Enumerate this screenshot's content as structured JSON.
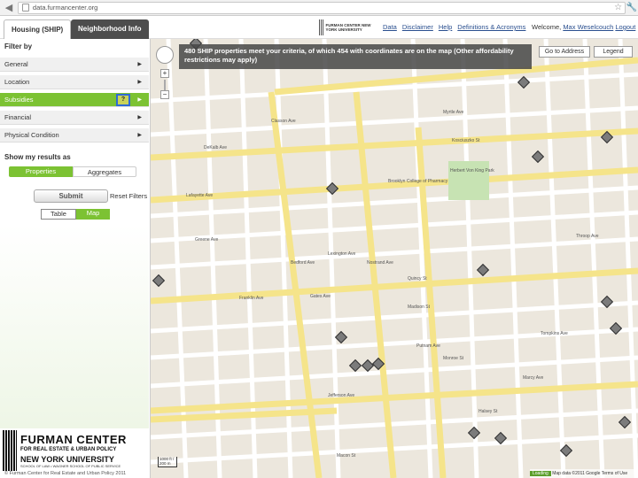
{
  "browser": {
    "url": "data.furmancenter.org"
  },
  "header": {
    "tabs": [
      {
        "label": "Housing (SHIP)"
      },
      {
        "label": "Neighborhood Info"
      }
    ],
    "links": [
      "Data",
      "Disclaimer",
      "Help",
      "Definitions & Acronyms"
    ],
    "welcome_prefix": "Welcome,",
    "user_name": "Max Weselcouch",
    "logout": "Logout",
    "nyu_logo_text": "FURMAN CENTER NEW YORK UNIVERSITY"
  },
  "sidebar": {
    "filter_title": "Filter by",
    "categories": [
      {
        "label": "General"
      },
      {
        "label": "Location"
      },
      {
        "label": "Subsidies"
      },
      {
        "label": "Financial"
      },
      {
        "label": "Physical Condition"
      }
    ],
    "help_label": "?",
    "show_results_title": "Show my results as",
    "result_modes": [
      "Properties",
      "Aggregates"
    ],
    "submit_label": "Submit",
    "reset_label": "Reset Filters",
    "view_modes": [
      "Table",
      "Map"
    ],
    "logo": {
      "line1": "FURMAN CENTER",
      "line2": "FOR REAL ESTATE & URBAN POLICY",
      "line3": "NEW YORK UNIVERSITY",
      "line4": "SCHOOL OF LAW • WAGNER SCHOOL OF PUBLIC SERVICE"
    },
    "copyright": "© Furman Center for Real Estate and Urban Policy 2011"
  },
  "map": {
    "banner_text": "480 SHIP properties meet your criteria, of which 454 with coordinates are on the map (Other affordability restrictions may apply)",
    "go_to_address": "Go to Address",
    "legend": "Legend",
    "zoom_in": "+",
    "zoom_out": "−",
    "scale_label": "1000 ft / 200 m",
    "footer_loading": "Loading",
    "footer_text": "Map data ©2011 Google",
    "footer_terms": "Terms of Use",
    "street_labels": [
      {
        "text": "DeKalb Ave"
      },
      {
        "text": "Lafayette Ave"
      },
      {
        "text": "Greene Ave"
      },
      {
        "text": "Gates Ave"
      },
      {
        "text": "Quincy St"
      },
      {
        "text": "Madison St"
      },
      {
        "text": "Putnam Ave"
      },
      {
        "text": "Monroe St"
      },
      {
        "text": "Jefferson Ave"
      },
      {
        "text": "Halsey St"
      },
      {
        "text": "Macon St"
      },
      {
        "text": "Bedford Ave"
      },
      {
        "text": "Nostrand Ave"
      },
      {
        "text": "Myrtle Ave"
      },
      {
        "text": "Lexington Ave"
      },
      {
        "text": "Franklin Ave"
      },
      {
        "text": "Classon Ave"
      },
      {
        "text": "Kosciuszko St"
      },
      {
        "text": "Brooklyn College of Pharmacy"
      },
      {
        "text": "Herbert Von King Park"
      },
      {
        "text": "Tompkins Ave"
      },
      {
        "text": "Throop Ave"
      },
      {
        "text": "Marcy Ave"
      }
    ],
    "colors": {
      "major_road": "#f5e48a",
      "minor_road": "#ffffff",
      "land": "#ece7dd",
      "park": "#c7e3b3",
      "accent_green": "#7cc233"
    }
  }
}
